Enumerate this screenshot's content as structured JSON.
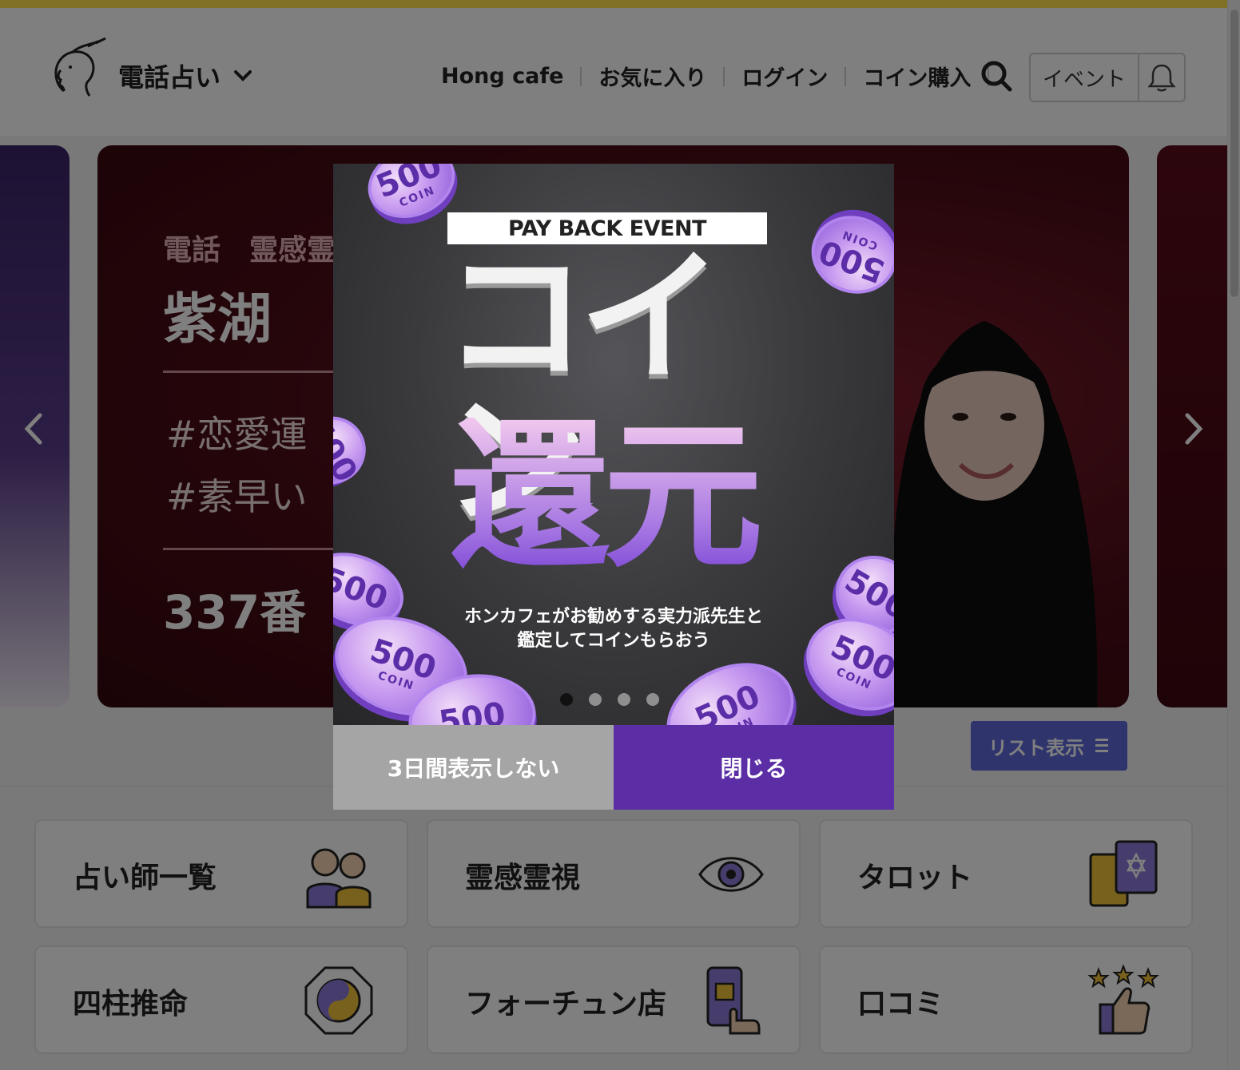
{
  "header": {
    "brand": "電話占い",
    "nav": [
      "Hong cafe",
      "お気に入り",
      "ログイン",
      "コイン購入"
    ],
    "event_label": "イベント"
  },
  "carousel": {
    "category_line": "電話　霊感霊",
    "name": "紫湖",
    "tags": [
      "#恋愛運",
      "#素早い"
    ],
    "number": "337番"
  },
  "list_button": {
    "label": "リスト表示"
  },
  "categories": [
    {
      "label": "占い師一覧",
      "icon": "people-icon"
    },
    {
      "label": "霊感霊視",
      "icon": "eye-icon"
    },
    {
      "label": "タロット",
      "icon": "tarot-card-icon"
    },
    {
      "label": "四柱推命",
      "icon": "yin-yang-icon"
    },
    {
      "label": "フォーチュン店",
      "icon": "phone-shop-icon"
    },
    {
      "label": "口コミ",
      "icon": "thumbs-up-stars-icon"
    }
  ],
  "modal": {
    "event_tag": "PAY BACK EVENT",
    "title": "コイン",
    "subtitle": "還元",
    "description_line1": "ホンカフェがお勧めする実力派先生と",
    "description_line2": "鑑定してコインもらおう",
    "coin_value": "500",
    "coin_label": "COIN",
    "hide_button": "3日間表示しない",
    "close_button": "閉じる"
  },
  "colors": {
    "brand_yellow": "#ffe24a",
    "accent_purple": "#5b2ea6",
    "list_button_blue": "#5f6ad8",
    "banner_red": "#4a0c16"
  }
}
